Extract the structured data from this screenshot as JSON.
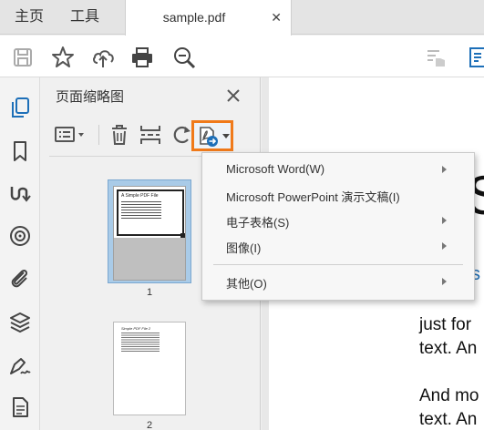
{
  "tabs": {
    "home": "主页",
    "tools": "工具",
    "document": "sample.pdf",
    "close_glyph": "✕"
  },
  "toolbar": {
    "icons": [
      "save-icon",
      "star-icon",
      "cloud-upload-icon",
      "print-icon",
      "zoom-out-icon",
      "read-aloud-icon",
      "export-pdf-icon"
    ]
  },
  "leftnav": {
    "icons": [
      "page-thumbnails-icon",
      "bookmark-icon",
      "link-icon",
      "target-icon",
      "attachment-icon",
      "layers-icon",
      "signature-icon",
      "document-icon"
    ]
  },
  "thumbnail_panel": {
    "title": "页面缩略图",
    "close_glyph": "✕",
    "pages": [
      {
        "number": "1",
        "title": "A Simple PDF File"
      },
      {
        "number": "2",
        "title": "Simple PDF File 2"
      }
    ]
  },
  "document": {
    "big_letter": "S",
    "small_letter": "s",
    "lines": [
      "just for",
      "text. An",
      "And mo",
      "text. An"
    ]
  },
  "menu": {
    "items": [
      {
        "label": "Microsoft Word(W)",
        "submenu": true
      },
      {
        "label": "Microsoft PowerPoint 演示文稿(I)",
        "submenu": false
      },
      {
        "label": "电子表格(S)",
        "submenu": true
      },
      {
        "label": "图像(I)",
        "submenu": true
      },
      {
        "label": "其他(O)",
        "submenu": true
      }
    ]
  },
  "colors": {
    "accent": "#f07a1a",
    "selection": "#a9cbe8",
    "icon_blue": "#1d6fb8"
  }
}
